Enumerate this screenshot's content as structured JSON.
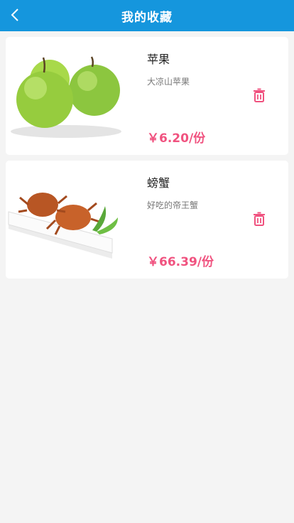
{
  "header": {
    "title": "我的收藏",
    "back_icon": "chevron-left-icon"
  },
  "favorites": [
    {
      "name": "苹果",
      "desc": "大凉山苹果",
      "price": "￥6.20/份",
      "image": "green-apples-image"
    },
    {
      "name": "螃蟹",
      "desc": "好吃的帝王蟹",
      "price": "￥66.39/份",
      "image": "crabs-on-plate-image"
    }
  ],
  "colors": {
    "header": "#1596dd",
    "accent": "#f0527f",
    "background": "#f4f4f4"
  }
}
